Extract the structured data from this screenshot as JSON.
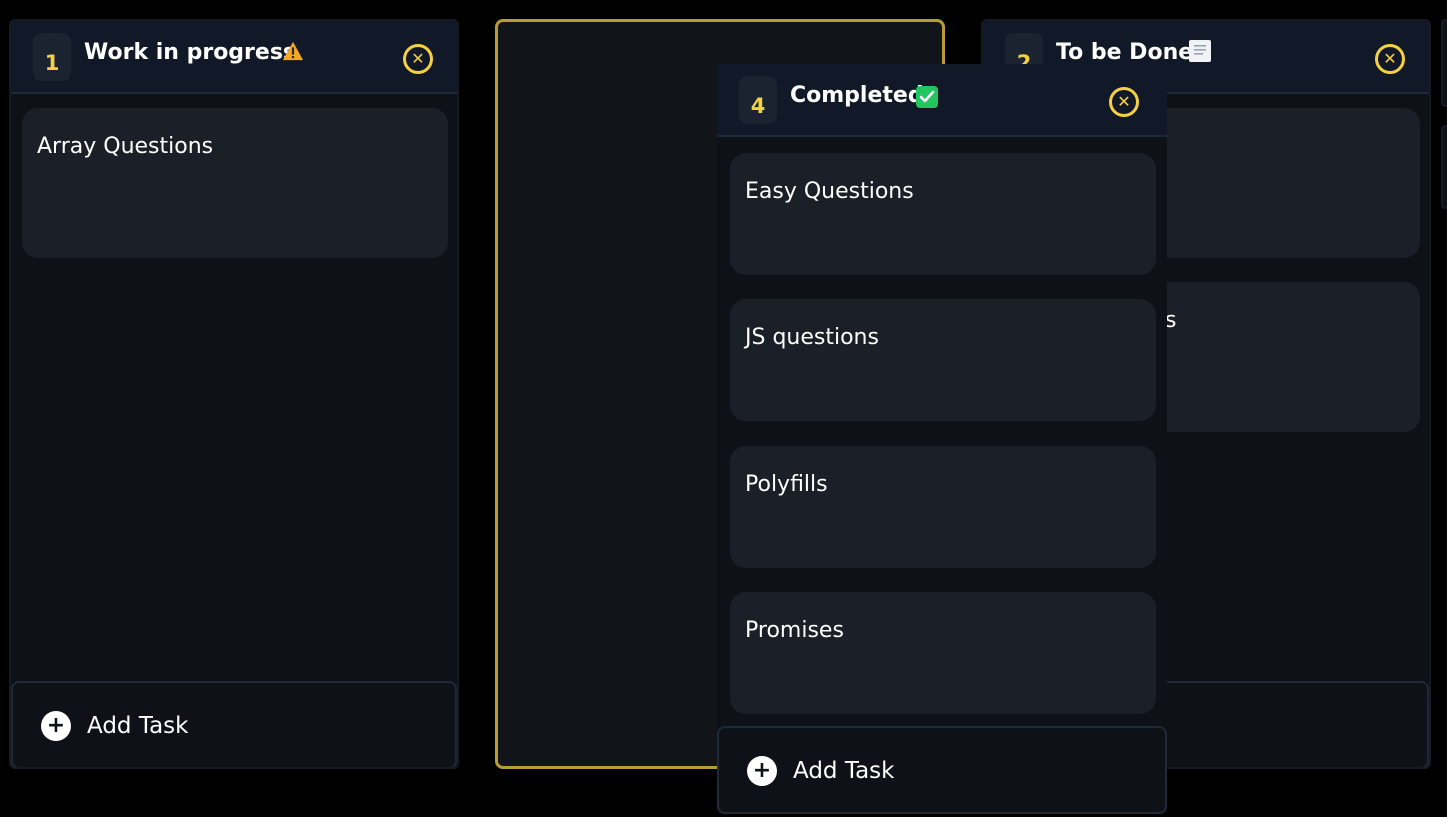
{
  "columns": {
    "work_in_progress": {
      "count": "1",
      "title": "Work in progress",
      "emoji": "⚠️",
      "tasks": [
        "Array Questions"
      ],
      "add_task_label": "Add Task"
    },
    "to_be_done": {
      "count": "2",
      "title": "To be Done",
      "emoji": "📃",
      "tasks": [
        "",
        "ns"
      ],
      "add_task_label": "Add Task"
    },
    "completed": {
      "count": "4",
      "title": "Completed",
      "emoji": "✅",
      "tasks": [
        "Easy Questions",
        "JS questions",
        "Polyfills",
        "Promises"
      ],
      "add_task_label": "Add Task"
    }
  },
  "icons": {
    "close": "close-circle-icon",
    "add": "plus-circle-icon",
    "warning": "warning-icon",
    "check": "check-icon",
    "scroll": "scroll-icon"
  },
  "colors": {
    "accent": "#f5d142",
    "placeholder_border": "#b89b32",
    "column_bg": "#0e1117",
    "header_bg": "#111827",
    "card_bg": "#1b1f27",
    "check_green": "#22c55e"
  }
}
